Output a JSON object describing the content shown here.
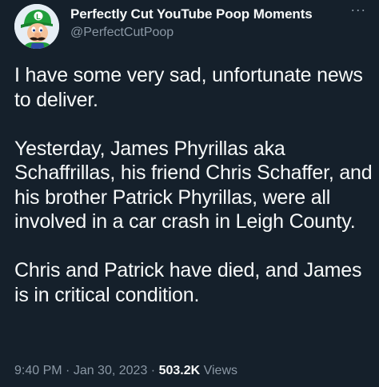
{
  "author": {
    "display_name": "Perfectly Cut YouTube Poop Moments",
    "handle": "@PerfectCutPoop",
    "avatar_icon": "luigi-avatar-icon"
  },
  "more_icon": "ellipsis-icon",
  "more_label": "···",
  "tweet": {
    "paragraphs": [
      "I have some very sad, unfortunate news to deliver.",
      "Yesterday, James Phyrillas aka Schaffrillas, his friend Chris Schaffer, and his brother Patrick Phyrillas, were all involved in a car crash in Leigh County.",
      "Chris and Patrick have died, and James is in critical condition."
    ]
  },
  "meta": {
    "time": "9:40 PM",
    "separator1": " · ",
    "date": "Jan 30, 2023",
    "separator2": " · ",
    "views_count": "503.2K",
    "views_label": " Views"
  },
  "colors": {
    "background": "#15202b",
    "text_primary": "#f7f9f9",
    "text_secondary": "#8b98a5"
  }
}
